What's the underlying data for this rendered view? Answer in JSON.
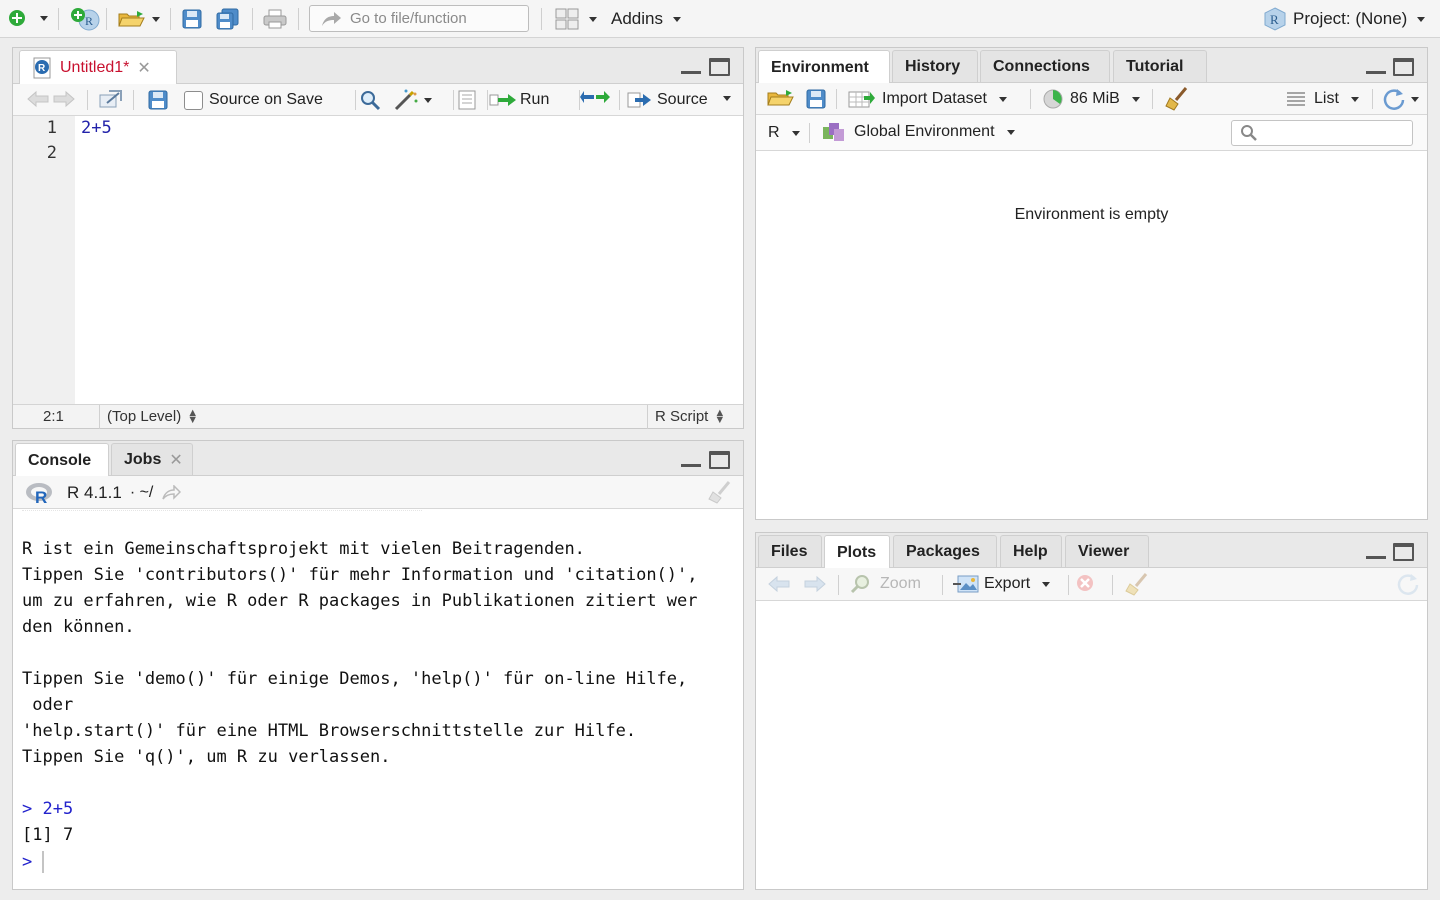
{
  "main_toolbar": {
    "goto_placeholder": "Go to file/function",
    "addins_label": "Addins",
    "project_label": "Project: (None)"
  },
  "editor": {
    "tab_label": "Untitled1*",
    "toolbar": {
      "source_on_save_label": "Source on Save",
      "run_label": "Run",
      "source_label": "Source"
    },
    "line_numbers": [
      "1",
      "2"
    ],
    "code_lines": [
      "2+5",
      ""
    ],
    "status": {
      "position": "2:1",
      "scope": "(Top Level)",
      "file_type": "R Script"
    }
  },
  "console": {
    "tabs": [
      {
        "label": "Console"
      },
      {
        "label": "Jobs"
      }
    ],
    "r_version": "R 4.1.1",
    "working_dir": "· ~/",
    "lines": [
      "R ist ein Gemeinschaftsprojekt mit vielen Beitragenden.",
      "Tippen Sie 'contributors()' für mehr Information und 'citation()',",
      "um zu erfahren, wie R oder R packages in Publikationen zitiert wer",
      "den können.",
      "",
      "Tippen Sie 'demo()' für einige Demos, 'help()' für on-line Hilfe,",
      " oder",
      "'help.start()' für eine HTML Browserschnittstelle zur Hilfe.",
      "Tippen Sie 'q()', um R zu verlassen.",
      ""
    ],
    "command_prompt": "> ",
    "command": "2+5",
    "output": "[1] 7",
    "input_prompt": ">"
  },
  "environment": {
    "tabs": [
      {
        "label": "Environment"
      },
      {
        "label": "History"
      },
      {
        "label": "Connections"
      },
      {
        "label": "Tutorial"
      }
    ],
    "import_label": "Import Dataset",
    "memory_label": "86 MiB",
    "list_label": "List",
    "lang_label": "R",
    "global_env_label": "Global Environment",
    "empty_message": "Environment is empty",
    "search_placeholder": ""
  },
  "files": {
    "tabs": [
      {
        "label": "Files"
      },
      {
        "label": "Plots"
      },
      {
        "label": "Packages"
      },
      {
        "label": "Help"
      },
      {
        "label": "Viewer"
      }
    ],
    "zoom_label": "Zoom",
    "export_label": "Export"
  },
  "colors": {
    "prompt_blue": "#2222cc",
    "code_blue": "#2222aa",
    "modified_tab_red": "#c8102e",
    "run_arrow_green": "#2eaa3a"
  }
}
